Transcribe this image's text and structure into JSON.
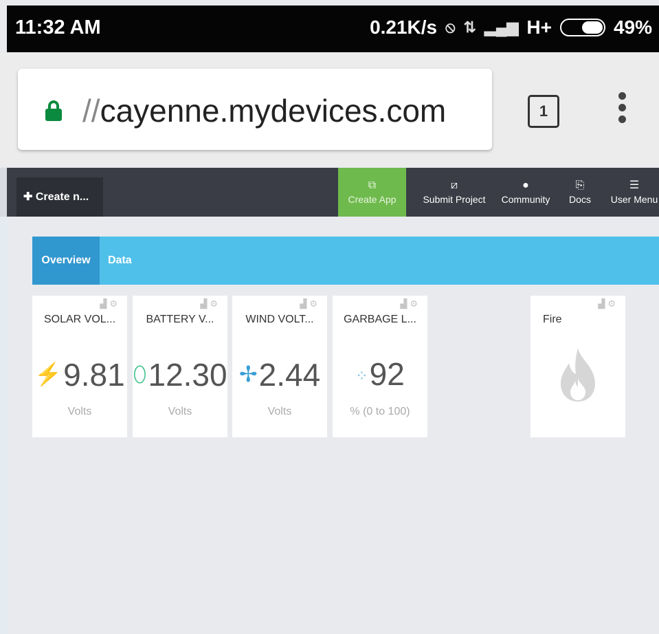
{
  "status_bar": {
    "time": "11:32 AM",
    "speed": "0.21K/s",
    "network": "H+",
    "battery": "49%"
  },
  "browser": {
    "url_prefix": "//",
    "url_host": "cayenne.mydevices.com",
    "tab_count": "1"
  },
  "app_nav": {
    "create_new": "Create n...",
    "items": [
      {
        "label": "Create App"
      },
      {
        "label": "Submit Project"
      },
      {
        "label": "Community"
      },
      {
        "label": "Docs"
      },
      {
        "label": "User Menu"
      }
    ]
  },
  "tabs": [
    {
      "label": "Overview",
      "active": true
    },
    {
      "label": "Data",
      "active": false
    }
  ],
  "widgets": [
    {
      "title": "SOLAR VOL...",
      "value": "9.81",
      "unit": "Volts",
      "icon": "lightning-icon",
      "icon_color": "#f2a81d"
    },
    {
      "title": "BATTERY V...",
      "value": "12.30",
      "unit": "Volts",
      "icon": "battery-icon",
      "icon_color": "#3cc08a"
    },
    {
      "title": "WIND VOLT...",
      "value": "2.44",
      "unit": "Volts",
      "icon": "fan-icon",
      "icon_color": "#3a9fd6"
    },
    {
      "title": "GARBAGE L...",
      "value": "92",
      "unit": "% (0 to 100)",
      "icon": "dots-icon",
      "icon_color": "#7cc4e6"
    },
    {
      "title": "Fire",
      "icon": "flame-icon",
      "icon_color": "#d6d6d6"
    }
  ],
  "colors": {
    "nav_bg": "#3a3d45",
    "create_app_bg": "#6fba4d",
    "tabs_bg": "#4fc0ea",
    "active_tab_bg": "#3197cf",
    "lock_green": "#0a8a3e"
  }
}
